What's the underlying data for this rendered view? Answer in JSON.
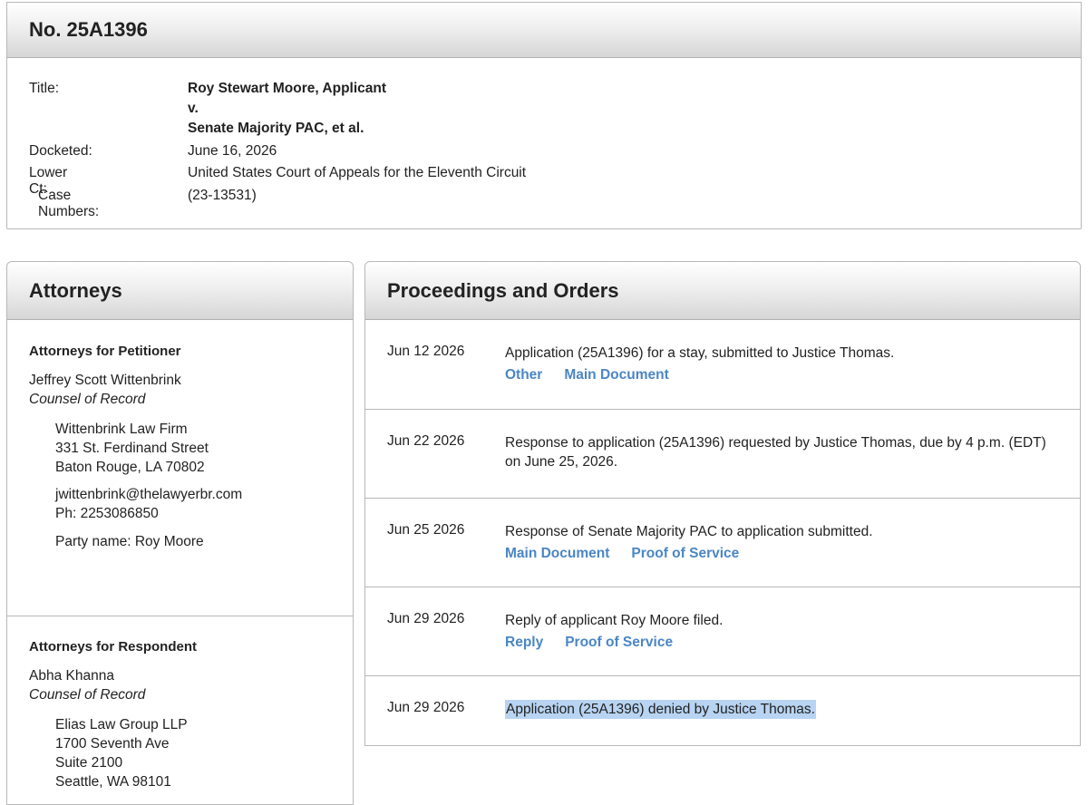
{
  "case": {
    "number": "No. 25A1396",
    "title_label": "Title:",
    "title_lines": [
      "Roy Stewart Moore, Applicant",
      "v.",
      "Senate Majority PAC, et al."
    ],
    "docketed_label": "Docketed:",
    "docketed": "June 16, 2026",
    "lower_ct_label": "Lower Ct:",
    "lower_ct": "United States Court of Appeals for the Eleventh Circuit",
    "case_numbers_label": "Case Numbers:",
    "case_numbers": "(23-13531)"
  },
  "attorneys": {
    "heading": "Attorneys",
    "petitioner": {
      "title": "Attorneys for Petitioner",
      "name": "Jeffrey Scott Wittenbrink",
      "role": "Counsel of Record",
      "address": [
        "Wittenbrink Law Firm",
        "331 St. Ferdinand Street",
        "Baton Rouge, LA 70802"
      ],
      "email": "jwittenbrink@thelawyerbr.com",
      "phone": "Ph: 2253086850",
      "party": "Party name: Roy Moore"
    },
    "respondent": {
      "title": "Attorneys for Respondent",
      "name": "Abha Khanna",
      "role": "Counsel of Record",
      "address": [
        "Elias Law Group LLP",
        "1700 Seventh Ave",
        "Suite 2100",
        "Seattle, WA 98101"
      ]
    }
  },
  "proceedings": {
    "heading": "Proceedings and Orders",
    "rows": [
      {
        "date": "Jun 12 2026",
        "text": "Application (25A1396) for a stay, submitted to Justice Thomas.",
        "links": [
          "Other",
          "Main Document"
        ]
      },
      {
        "date": "Jun 22 2026",
        "text": "Response to application (25A1396) requested by Justice Thomas, due by 4 p.m. (EDT) on June 25, 2026.",
        "links": []
      },
      {
        "date": "Jun 25 2026",
        "text": "Response of Senate Majority PAC to application submitted.",
        "links": [
          "Main Document",
          "Proof of Service"
        ]
      },
      {
        "date": "Jun 29 2026",
        "text": "Reply of applicant Roy Moore filed.",
        "links": [
          "Reply",
          "Proof of Service"
        ]
      },
      {
        "date": "Jun 29 2026",
        "text": "Application (25A1396) denied by Justice Thomas.",
        "links": []
      }
    ]
  },
  "colors": {
    "link": "#4a86c5",
    "highlight": "#b8d4f2"
  }
}
